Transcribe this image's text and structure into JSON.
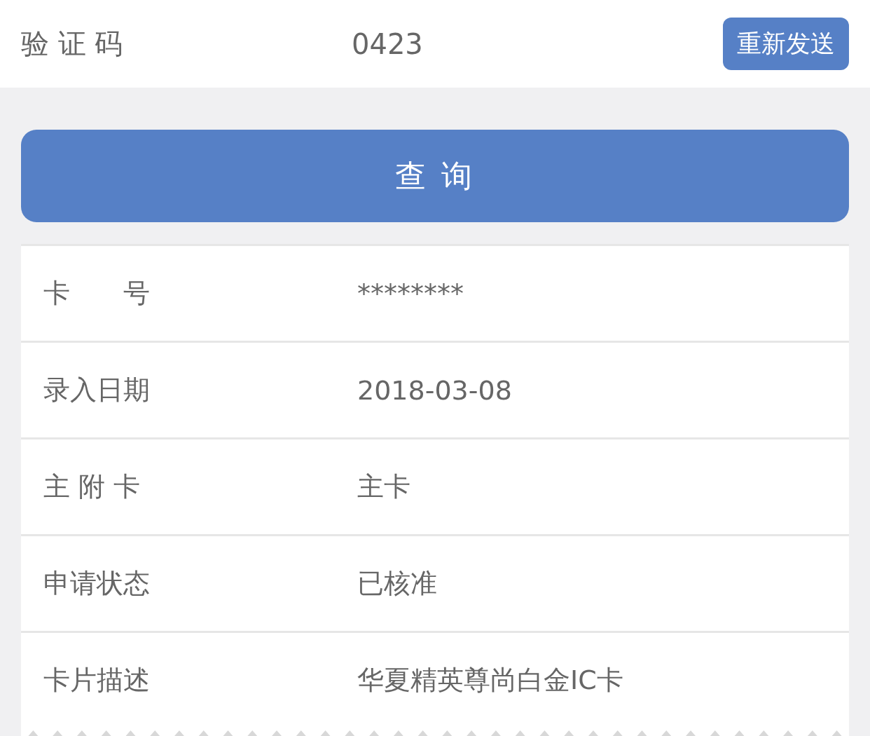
{
  "verification": {
    "label": "验 证 码",
    "value": "0423",
    "resend_button": "重新发送"
  },
  "query_button": "查 询",
  "details": [
    {
      "label": "卡　　号",
      "value": "********"
    },
    {
      "label": "录入日期",
      "value": "2018-03-08"
    },
    {
      "label": "主 附 卡",
      "value": "主卡"
    },
    {
      "label": "申请状态",
      "value": "已核准"
    },
    {
      "label": "卡片描述",
      "value": "华夏精英尊尚白金IC卡"
    }
  ]
}
